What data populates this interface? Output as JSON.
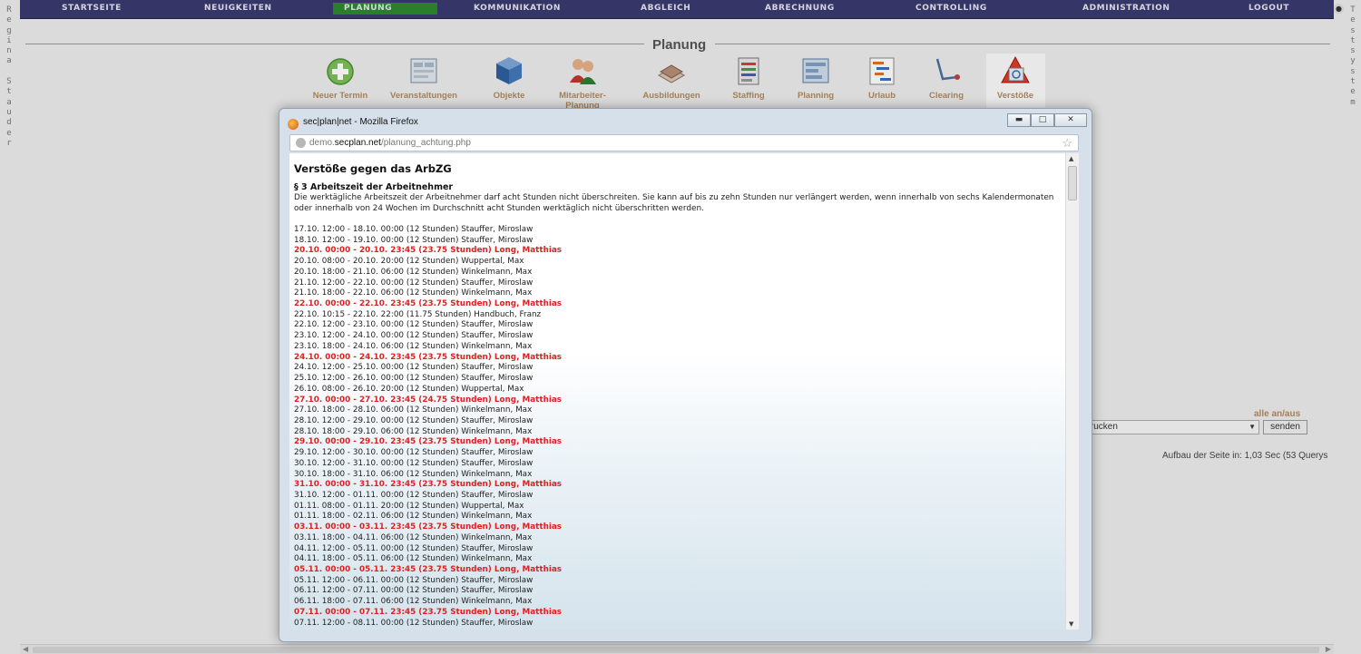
{
  "nav": {
    "items": [
      "STARTSEITE",
      "NEUIGKEITEN",
      "PLANUNG",
      "KOMMUNIKATION",
      "ABGLEICH",
      "ABRECHNUNG",
      "CONTROLLING",
      "ADMINISTRATION",
      "LOGOUT"
    ],
    "active": "PLANUNG",
    "active_color": "#2e8a2e",
    "bg_color": "#3a3a70"
  },
  "side_left": "Regina Stauder",
  "side_right": "Testsystem",
  "page_title": "Planung",
  "toolbar": {
    "items": [
      {
        "label": "Neuer Termin",
        "icon": "plus-circle-icon"
      },
      {
        "label": "Veranstaltungen",
        "icon": "events-icon"
      },
      {
        "label": "Objekte",
        "icon": "cube-icon"
      },
      {
        "label": "Mitarbeiter-Planung",
        "icon": "people-icon"
      },
      {
        "label": "Ausbildungen",
        "icon": "books-icon"
      },
      {
        "label": "Staffing",
        "icon": "clipboard-icon"
      },
      {
        "label": "Planning",
        "icon": "planning-board-icon"
      },
      {
        "label": "Urlaub",
        "icon": "gantt-icon"
      },
      {
        "label": "Clearing",
        "icon": "clearing-icon"
      },
      {
        "label": "Verstöße",
        "icon": "warning-icon"
      }
    ],
    "active": "Verstöße"
  },
  "background": {
    "toggle_link": "alle an/aus",
    "print_select": "n drucken",
    "send_button": "senden",
    "build_time": "Aufbau der Seite in: 1,03 Sec (53 Querys"
  },
  "popup": {
    "window_title": "sec|plan|net - Mozilla Firefox",
    "url_domain_prefix": "demo.",
    "url_domain": "secplan.net",
    "url_path": "/planung_achtung.php",
    "heading": "Verstöße gegen das ArbZG",
    "section_title": "§ 3 Arbeitszeit der Arbeitnehmer",
    "section_text": "Die werktägliche Arbeitszeit der Arbeitnehmer darf acht Stunden nicht überschreiten. Sie kann auf bis zu zehn Stunden nur verlängert werden, wenn innerhalb von sechs Kalendermonaten oder innerhalb von 24 Wochen im Durchschnitt acht Stunden werktäglich nicht überschritten werden.",
    "highlight_color": "#e02020",
    "entries": [
      {
        "text": "17.10. 12:00 - 18.10. 00:00 (12 Stunden) Stauffer, Miroslaw",
        "violation": false
      },
      {
        "text": "18.10. 12:00 - 19.10. 00:00 (12 Stunden) Stauffer, Miroslaw",
        "violation": false
      },
      {
        "text": "20.10. 00:00 - 20.10. 23:45 (23.75 Stunden) Long, Matthias",
        "violation": true
      },
      {
        "text": "20.10. 08:00 - 20.10. 20:00 (12 Stunden) Wuppertal, Max",
        "violation": false
      },
      {
        "text": "20.10. 18:00 - 21.10. 06:00 (12 Stunden) Winkelmann, Max",
        "violation": false
      },
      {
        "text": "21.10. 12:00 - 22.10. 00:00 (12 Stunden) Stauffer, Miroslaw",
        "violation": false
      },
      {
        "text": "21.10. 18:00 - 22.10. 06:00 (12 Stunden) Winkelmann, Max",
        "violation": false
      },
      {
        "text": "22.10. 00:00 - 22.10. 23:45 (23.75 Stunden) Long, Matthias",
        "violation": true
      },
      {
        "text": "22.10. 10:15 - 22.10. 22:00 (11.75 Stunden) Handbuch, Franz",
        "violation": false
      },
      {
        "text": "22.10. 12:00 - 23.10. 00:00 (12 Stunden) Stauffer, Miroslaw",
        "violation": false
      },
      {
        "text": "23.10. 12:00 - 24.10. 00:00 (12 Stunden) Stauffer, Miroslaw",
        "violation": false
      },
      {
        "text": "23.10. 18:00 - 24.10. 06:00 (12 Stunden) Winkelmann, Max",
        "violation": false
      },
      {
        "text": "24.10. 00:00 - 24.10. 23:45 (23.75 Stunden) Long, Matthias",
        "violation": true
      },
      {
        "text": "24.10. 12:00 - 25.10. 00:00 (12 Stunden) Stauffer, Miroslaw",
        "violation": false
      },
      {
        "text": "25.10. 12:00 - 26.10. 00:00 (12 Stunden) Stauffer, Miroslaw",
        "violation": false
      },
      {
        "text": "26.10. 08:00 - 26.10. 20:00 (12 Stunden) Wuppertal, Max",
        "violation": false
      },
      {
        "text": "27.10. 00:00 - 27.10. 23:45 (24.75 Stunden) Long, Matthias",
        "violation": true
      },
      {
        "text": "27.10. 18:00 - 28.10. 06:00 (12 Stunden) Winkelmann, Max",
        "violation": false
      },
      {
        "text": "28.10. 12:00 - 29.10. 00:00 (12 Stunden) Stauffer, Miroslaw",
        "violation": false
      },
      {
        "text": "28.10. 18:00 - 29.10. 06:00 (12 Stunden) Winkelmann, Max",
        "violation": false
      },
      {
        "text": "29.10. 00:00 - 29.10. 23:45 (23.75 Stunden) Long, Matthias",
        "violation": true
      },
      {
        "text": "29.10. 12:00 - 30.10. 00:00 (12 Stunden) Stauffer, Miroslaw",
        "violation": false
      },
      {
        "text": "30.10. 12:00 - 31.10. 00:00 (12 Stunden) Stauffer, Miroslaw",
        "violation": false
      },
      {
        "text": "30.10. 18:00 - 31.10. 06:00 (12 Stunden) Winkelmann, Max",
        "violation": false
      },
      {
        "text": "31.10. 00:00 - 31.10. 23:45 (23.75 Stunden) Long, Matthias",
        "violation": true
      },
      {
        "text": "31.10. 12:00 - 01.11. 00:00 (12 Stunden) Stauffer, Miroslaw",
        "violation": false
      },
      {
        "text": "01.11. 08:00 - 01.11. 20:00 (12 Stunden) Wuppertal, Max",
        "violation": false
      },
      {
        "text": "01.11. 18:00 - 02.11. 06:00 (12 Stunden) Winkelmann, Max",
        "violation": false
      },
      {
        "text": "03.11. 00:00 - 03.11. 23:45 (23.75 Stunden) Long, Matthias",
        "violation": true
      },
      {
        "text": "03.11. 18:00 - 04.11. 06:00 (12 Stunden) Winkelmann, Max",
        "violation": false
      },
      {
        "text": "04.11. 12:00 - 05.11. 00:00 (12 Stunden) Stauffer, Miroslaw",
        "violation": false
      },
      {
        "text": "04.11. 18:00 - 05.11. 06:00 (12 Stunden) Winkelmann, Max",
        "violation": false
      },
      {
        "text": "05.11. 00:00 - 05.11. 23:45 (23.75 Stunden) Long, Matthias",
        "violation": true
      },
      {
        "text": "05.11. 12:00 - 06.11. 00:00 (12 Stunden) Stauffer, Miroslaw",
        "violation": false
      },
      {
        "text": "06.11. 12:00 - 07.11. 00:00 (12 Stunden) Stauffer, Miroslaw",
        "violation": false
      },
      {
        "text": "06.11. 18:00 - 07.11. 06:00 (12 Stunden) Winkelmann, Max",
        "violation": false
      },
      {
        "text": "07.11. 00:00 - 07.11. 23:45 (23.75 Stunden) Long, Matthias",
        "violation": true
      },
      {
        "text": "07.11. 12:00 - 08.11. 00:00 (12 Stunden) Stauffer, Miroslaw",
        "violation": false
      }
    ]
  }
}
